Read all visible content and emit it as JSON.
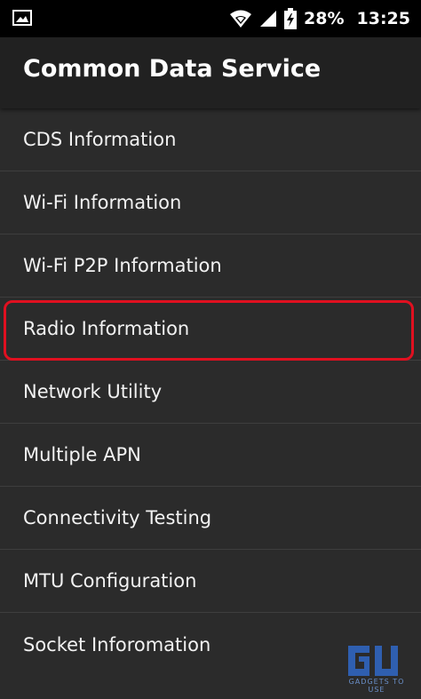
{
  "status_bar": {
    "battery": "28%",
    "time": "13:25",
    "icons": [
      "image-icon",
      "wifi-icon",
      "signal-icon",
      "battery-charging-icon"
    ]
  },
  "app_bar": {
    "title": "Common Data Service"
  },
  "menu": {
    "items": [
      {
        "label": "CDS Information"
      },
      {
        "label": "Wi-Fi Information"
      },
      {
        "label": "Wi-Fi P2P Information"
      },
      {
        "label": "Radio Information",
        "highlighted": true
      },
      {
        "label": "Network Utility"
      },
      {
        "label": "Multiple APN"
      },
      {
        "label": "Connectivity Testing"
      },
      {
        "label": "MTU Configuration"
      },
      {
        "label": "Socket Inforomation"
      }
    ]
  },
  "watermark": {
    "text": "GADGETS TO USE"
  },
  "colors": {
    "background": "#2b2b2b",
    "app_bar": "#212121",
    "status_bar": "#000000",
    "highlight": "#e01020",
    "divider": "#3e3e3e"
  }
}
